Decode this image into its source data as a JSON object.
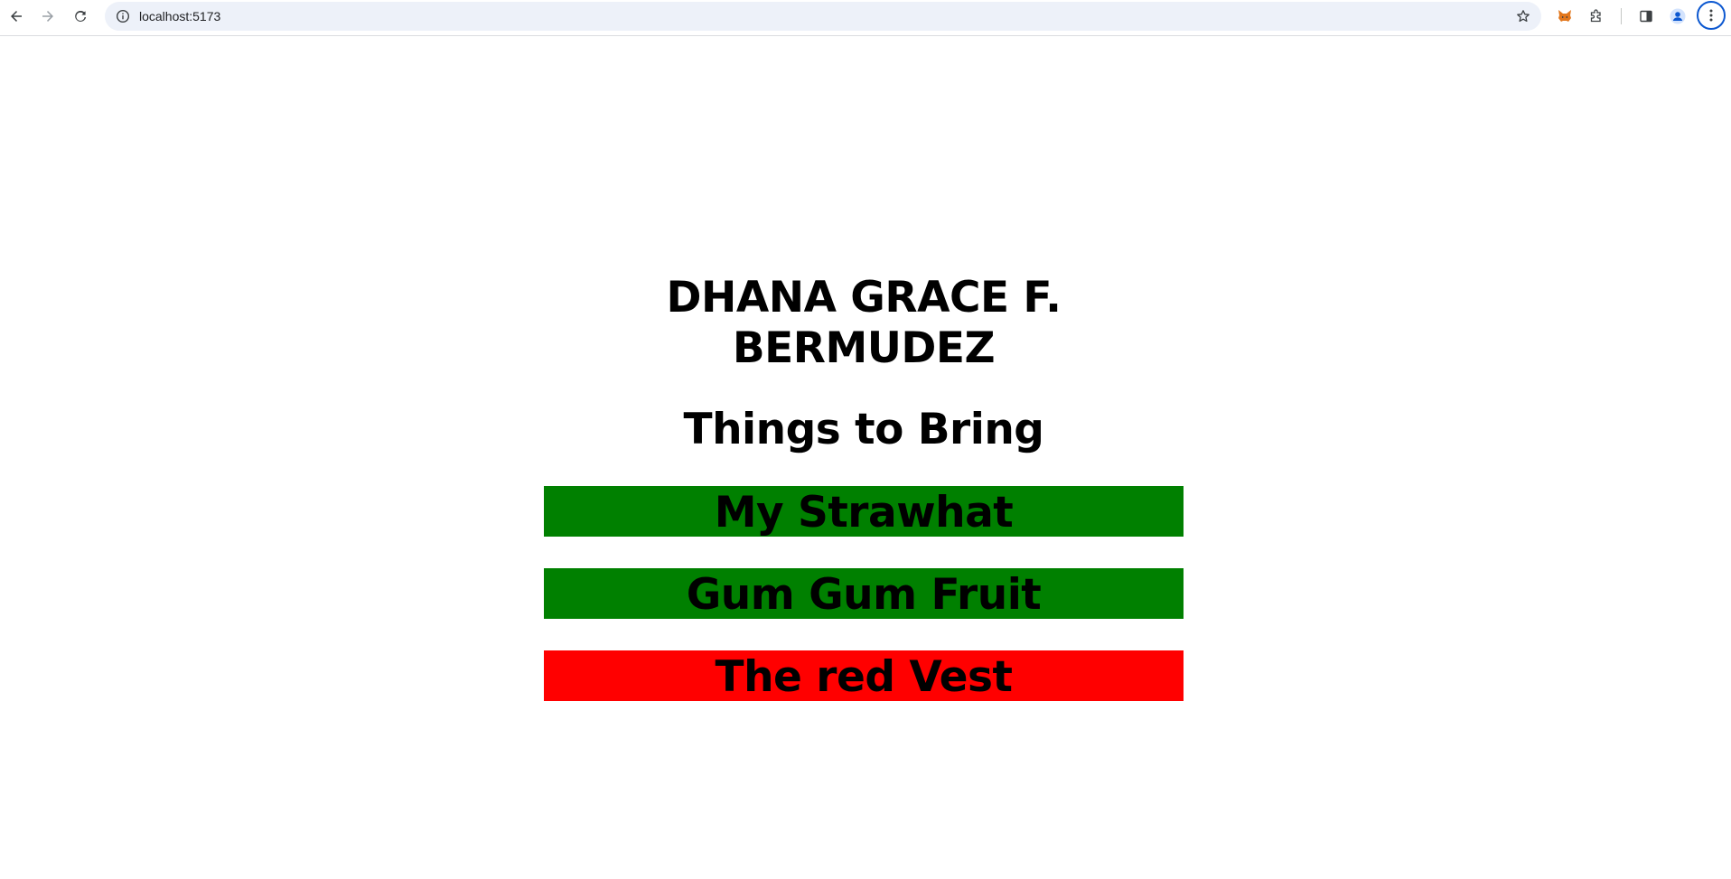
{
  "browser": {
    "url": "localhost:5173",
    "icons": {
      "back": "back-arrow-icon",
      "forward": "forward-arrow-icon",
      "reload": "reload-icon",
      "site_info": "info-icon",
      "bookmark": "star-icon",
      "metamask": "fox-extension-icon",
      "extensions": "puzzle-icon",
      "side_panel": "side-panel-icon",
      "profile": "profile-icon",
      "menu": "kebab-menu-icon"
    }
  },
  "page": {
    "name": "DHANA GRACE F. BERMUDEZ",
    "title": "Things to Bring",
    "items": [
      {
        "label": "My Strawhat",
        "color": "#008000"
      },
      {
        "label": "Gum Gum Fruit",
        "color": "#008000"
      },
      {
        "label": "The red Vest",
        "color": "#ff0000"
      }
    ]
  }
}
